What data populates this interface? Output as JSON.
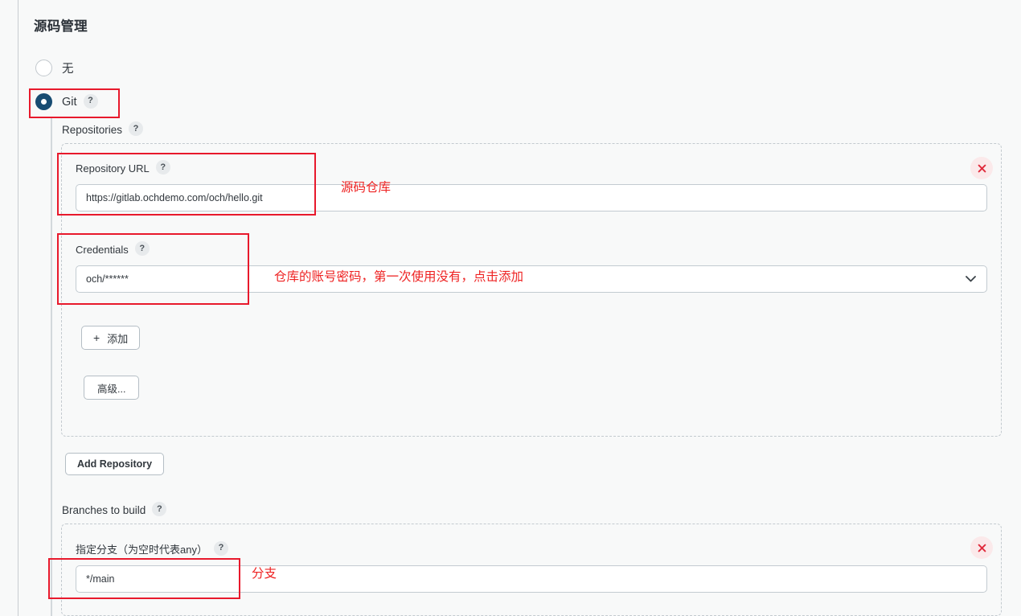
{
  "page": {
    "title": "源码管理"
  },
  "scm": {
    "options": [
      {
        "label": "无",
        "value": "none",
        "checked": false
      },
      {
        "label": "Git",
        "value": "git",
        "checked": true,
        "help": "?"
      }
    ]
  },
  "repositories": {
    "label": "Repositories",
    "help": "?",
    "remove_label": "×",
    "repo_url": {
      "label": "Repository URL",
      "help": "?",
      "value": "https://gitlab.ochdemo.com/och/hello.git",
      "placeholder": ""
    },
    "credentials": {
      "label": "Credentials",
      "help": "?",
      "value": "och/******",
      "options": [
        "och/******"
      ]
    },
    "add_credentials_button": {
      "icon": "plus-icon",
      "plus": "+",
      "label": "添加"
    },
    "advanced_button": {
      "label": "高级..."
    },
    "add_repository_button": {
      "label": "Add Repository"
    }
  },
  "branches": {
    "label": "Branches to build",
    "help": "?",
    "remove_label": "×",
    "branch_specifier": {
      "label": "指定分支（为空时代表any）",
      "help": "?",
      "value": "*/main",
      "placeholder": ""
    }
  },
  "annotations": {
    "color": "#ee2222",
    "repo_url_note": "源码仓库",
    "credentials_note": "仓库的账号密码，第一次使用没有，点击添加",
    "branch_note": "分支"
  },
  "colors": {
    "page_background": "#f8f9f9",
    "radio_selected": "#174c72",
    "annotation_red": "#ee2222",
    "remove_bg": "#fbe9ea",
    "remove_fg": "#e02b3c",
    "dashed_border": "#c3cacf"
  }
}
